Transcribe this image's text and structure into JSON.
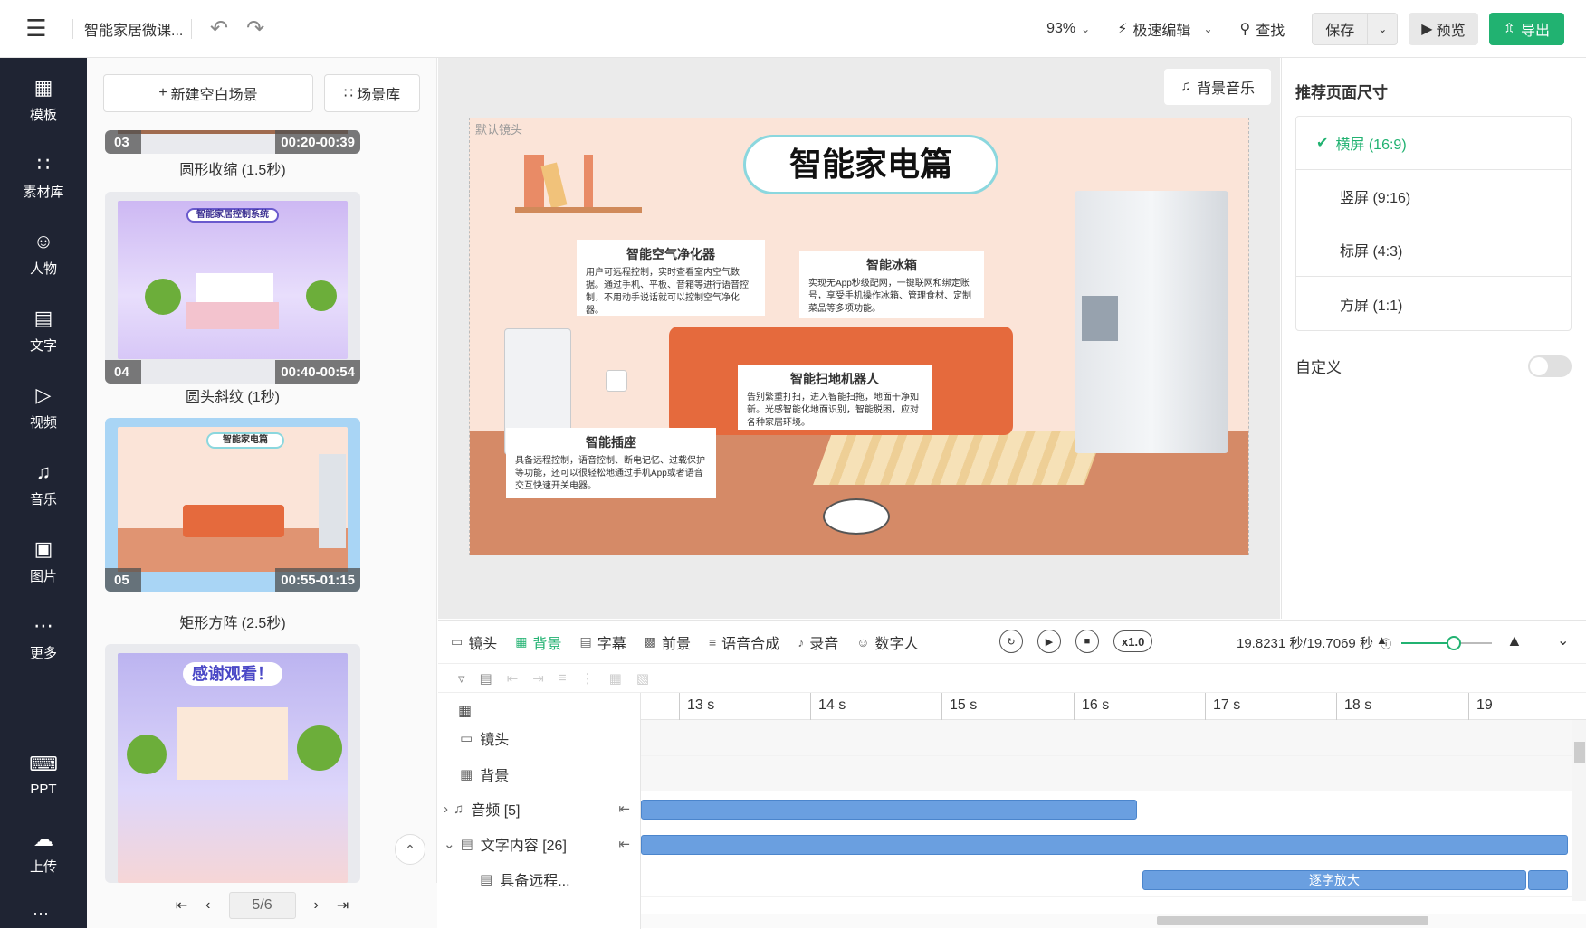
{
  "topbar": {
    "doc_title": "智能家居微课...",
    "zoom": "93%",
    "fast_edit": "极速编辑",
    "find": "查找",
    "save": "保存",
    "preview": "预览",
    "export": "导出"
  },
  "sidebar": {
    "items": [
      {
        "label": "模板",
        "icon": "template-icon"
      },
      {
        "label": "素材库",
        "icon": "assets-icon"
      },
      {
        "label": "人物",
        "icon": "person-icon"
      },
      {
        "label": "文字",
        "icon": "text-icon"
      },
      {
        "label": "视频",
        "icon": "video-icon"
      },
      {
        "label": "音乐",
        "icon": "music-icon"
      },
      {
        "label": "图片",
        "icon": "image-icon"
      },
      {
        "label": "更多",
        "icon": "more-icon"
      },
      {
        "label": "PPT",
        "icon": "ppt-icon"
      },
      {
        "label": "上传",
        "icon": "upload-icon"
      }
    ]
  },
  "scenes": {
    "new_blank": "新建空白场景",
    "library": "场景库",
    "items": [
      {
        "num": "03",
        "time": "00:20-00:39",
        "transition": "圆形收缩 (1.5秒)"
      },
      {
        "num": "04",
        "time": "00:40-00:54",
        "transition": "圆头斜纹 (1秒)",
        "heading": "智能家居控制系统"
      },
      {
        "num": "05",
        "time": "00:55-01:15",
        "transition": "矩形方阵 (2.5秒)",
        "heading": "智能家电篇"
      },
      {
        "heading": "感谢观看！"
      }
    ],
    "pager": {
      "current": "5/6"
    }
  },
  "canvas": {
    "bgm": "背景音乐",
    "camera_label": "默认镜头",
    "title": "智能家电篇",
    "cards": [
      {
        "title": "智能空气净化器",
        "body": "用户可远程控制，实时查看室内空气数据。通过手机、平板、音箱等进行语音控制，不用动手说话就可以控制空气净化器。"
      },
      {
        "title": "智能冰箱",
        "body": "实现无App秒级配网，一键联网和绑定账号，享受手机操作冰箱、管理食材、定制菜品等多项功能。"
      },
      {
        "title": "智能扫地机器人",
        "body": "告别繁重打扫，进入智能扫拖，地面干净如新。光感智能化地面识别，智能脱困，应对各种家居环境。"
      },
      {
        "title": "智能插座",
        "body": "具备远程控制，语音控制、断电记忆、过载保护等功能，还可以很轻松地通过手机App或者语音交互快速开关电器。"
      }
    ]
  },
  "right_panel": {
    "title": "推荐页面尺寸",
    "sizes": [
      "横屏 (16:9)",
      "竖屏 (9:16)",
      "标屏 (4:3)",
      "方屏 (1:1)"
    ],
    "active_size": 0,
    "custom": "自定义"
  },
  "timeline": {
    "tabs": [
      "镜头",
      "背景",
      "字幕",
      "前景",
      "语音合成",
      "录音",
      "数字人"
    ],
    "active_tab": 1,
    "speed": "x1.0",
    "time_readout": "19.8231 秒/19.7069 秒",
    "zoom_level": 0.58,
    "ruler": [
      "13 s",
      "14 s",
      "15 s",
      "16 s",
      "17 s",
      "18 s",
      "19"
    ],
    "tracks": [
      "镜头",
      "背景",
      "音频 [5]",
      "文字内容 [26]",
      "具备远程..."
    ],
    "clip_label": "逐字放大",
    "colors": {
      "accent": "#21b271",
      "clip": "#6a9fe0"
    }
  }
}
